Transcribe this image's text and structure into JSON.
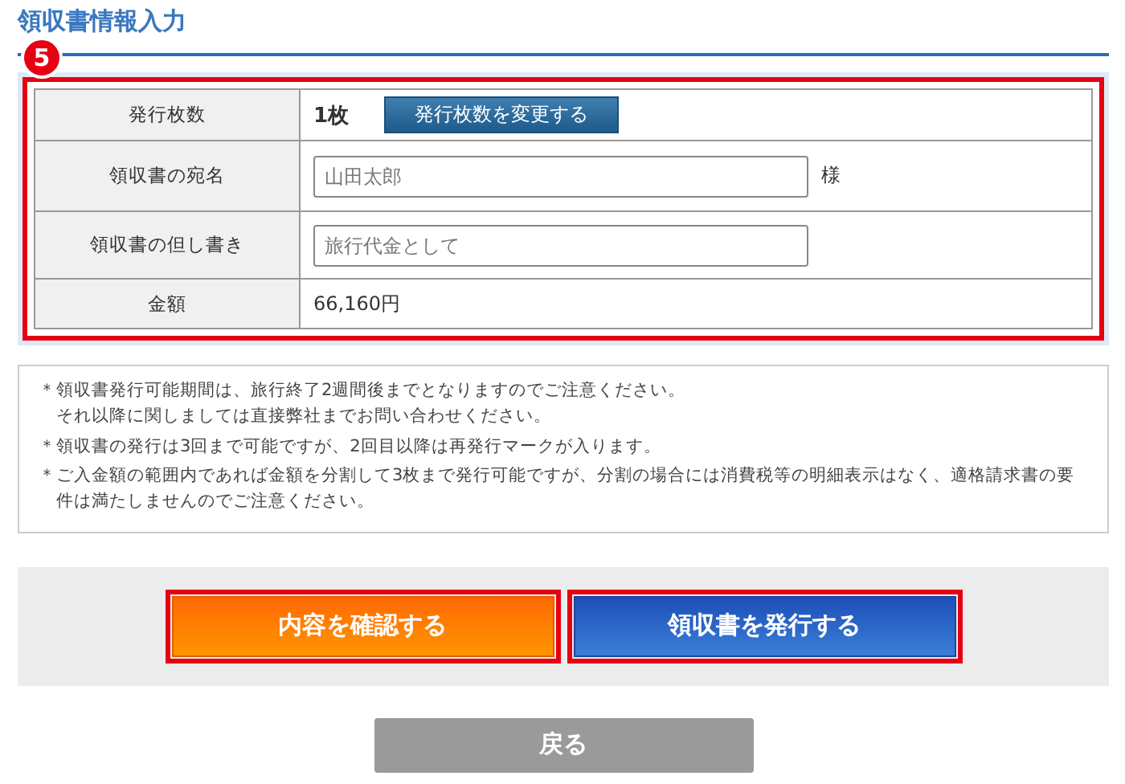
{
  "section_title": "領収書情報入力",
  "step_badge": "5",
  "form": {
    "rows": [
      {
        "kind": "count",
        "label": "発行枚数",
        "value": "1枚",
        "button": "発行枚数を変更する"
      },
      {
        "kind": "input",
        "label": "領収書の宛名",
        "placeholder": "山田太郎",
        "suffix": "様"
      },
      {
        "kind": "input",
        "label": "領収書の但し書き",
        "placeholder": "旅行代金として"
      },
      {
        "kind": "text",
        "label": "金額",
        "value": "66,160円"
      }
    ]
  },
  "notes": [
    {
      "mark": "＊",
      "lines": [
        "領収書発行可能期間は、旅行終了2週間後までとなりますのでご注意ください。",
        "それ以降に関しましては直接弊社までお問い合わせください。"
      ]
    },
    {
      "mark": "＊",
      "lines": [
        "領収書の発行は3回まで可能ですが、2回目以降は再発行マークが入ります。"
      ]
    },
    {
      "mark": "＊",
      "lines": [
        "ご入金額の範囲内であれば金額を分割して3枚まで発行可能ですが、分割の場合には消費税等の明細表示はなく、適格請求書の要件は満たしませんのでご注意ください。"
      ]
    }
  ],
  "actions": [
    {
      "kind": "orange",
      "label": "内容を確認する"
    },
    {
      "kind": "blue",
      "label": "領収書を発行する"
    }
  ],
  "back_button": "戻る"
}
